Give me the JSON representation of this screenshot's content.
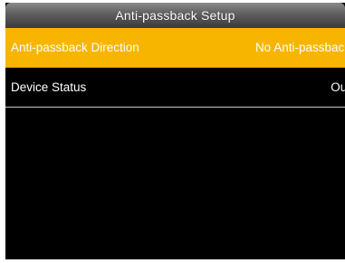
{
  "screen": {
    "title": "Anti-passback Setup"
  },
  "menu": {
    "items": [
      {
        "label": "Anti-passback  Direction",
        "value": "No Anti-passback",
        "selected": true
      },
      {
        "label": "Device Status",
        "value": "Out",
        "selected": false
      }
    ]
  },
  "colors": {
    "selection_highlight": "#f7b500",
    "screen_background": "#000000",
    "title_bar": "#5e5e5e",
    "text": "#ffffff"
  }
}
